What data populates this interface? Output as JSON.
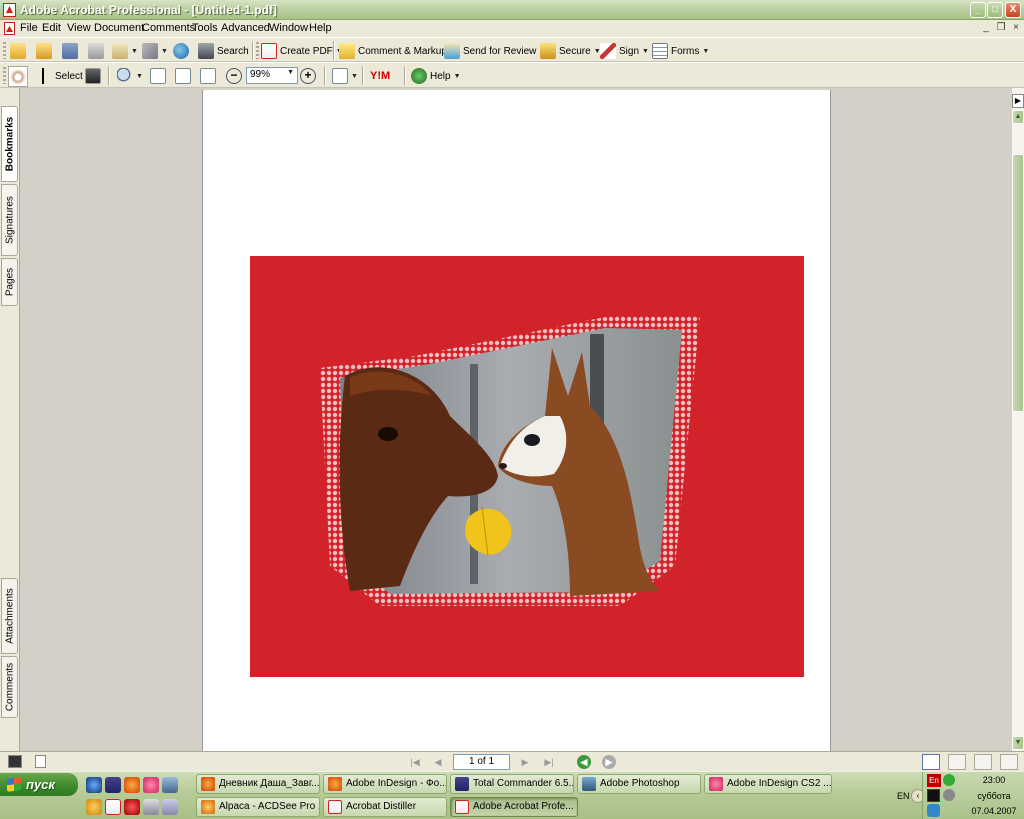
{
  "window": {
    "title": "Adobe Acrobat Professional - [Untitled-1.pdf]",
    "controls": {
      "minimize": "_",
      "maximize": "□",
      "close": "X"
    }
  },
  "menu": {
    "items": [
      "File",
      "Edit",
      "View",
      "Document",
      "Comments",
      "Tools",
      "Advanced",
      "Window",
      "Help"
    ],
    "mdi": {
      "minimize": "_",
      "restore": "❐",
      "close": "×"
    }
  },
  "toolbar1": {
    "search_label": "Search",
    "create_pdf_label": "Create PDF",
    "comment_markup_label": "Comment & Markup",
    "send_review_label": "Send for Review",
    "secure_label": "Secure",
    "sign_label": "Sign",
    "forms_label": "Forms",
    "dropdown_glyph": "▼"
  },
  "toolbar2": {
    "select_label": "Select",
    "zoom_value": "99%",
    "help_label": "Help",
    "yahoo_label": "Y!M",
    "minus_glyph": "−",
    "plus_glyph": "+"
  },
  "nav_tabs": {
    "bookmarks": "Bookmarks",
    "signatures": "Signatures",
    "pages": "Pages",
    "attachments": "Attachments",
    "comments": "Comments"
  },
  "document": {
    "background_color": "#d2232a",
    "image_subject": "alpaca"
  },
  "statusbar": {
    "page_indicator": "1 of 1",
    "first_glyph": "|◀",
    "prev_glyph": "◀",
    "next_glyph": "▶",
    "last_glyph": "▶|",
    "back_glyph": "◀",
    "forward_glyph": "▶"
  },
  "scroll": {
    "up": "▲",
    "down": "▼",
    "collapse": "▶"
  },
  "taskbar": {
    "start_label": "пуск",
    "tasks_row1": [
      "Дневник Даша_Завг...",
      "Adobe InDesign - Фо...",
      "Total Commander 6.5...",
      "Adobe Photoshop",
      "Adobe InDesign CS2 ..."
    ],
    "tasks_row2": [
      "Alpaca - ACDSee Pro ...",
      "Acrobat Distiller",
      "Adobe Acrobat Profe..."
    ],
    "tray": {
      "lang_indicator": "En",
      "lang_code": "EN",
      "time": "23:00",
      "day": "суббота",
      "date": "07.04.2007"
    }
  }
}
